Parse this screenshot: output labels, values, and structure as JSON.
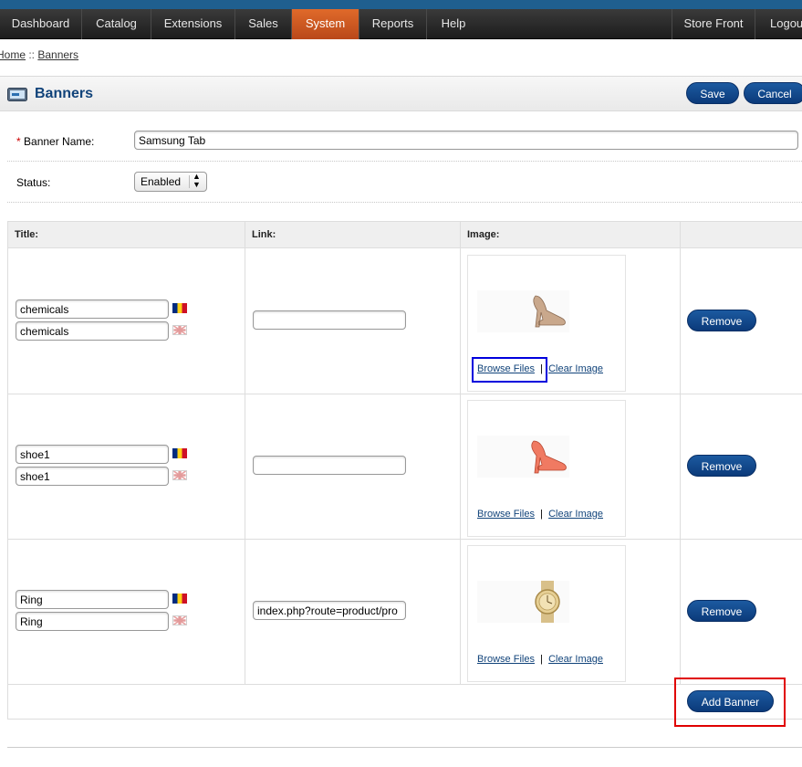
{
  "menu": {
    "items": [
      "Dashboard",
      "Catalog",
      "Extensions",
      "Sales",
      "System",
      "Reports",
      "Help"
    ],
    "active": "System",
    "right_items": [
      "Store Front",
      "Logout"
    ]
  },
  "breadcrumb": {
    "home": "Home",
    "sep": " :: ",
    "current": "Banners"
  },
  "heading": {
    "title": "Banners",
    "save": "Save",
    "cancel": "Cancel"
  },
  "form": {
    "banner_name_label": "Banner Name:",
    "required_mark": "*",
    "banner_name_value": "Samsung Tab",
    "status_label": "Status:",
    "status_value": "Enabled"
  },
  "table": {
    "headers": {
      "title": "Title:",
      "link": "Link:",
      "image": "Image:"
    },
    "rows": [
      {
        "title_ro": "chemicals",
        "title_en": "chemicals",
        "link": "",
        "image_icon": "beige-high-heel-shoe-image"
      },
      {
        "title_ro": "shoe1",
        "title_en": "shoe1",
        "link": "",
        "image_icon": "coral-high-heel-shoe-image"
      },
      {
        "title_ro": "Ring",
        "title_en": "Ring",
        "link": "index.php?route=product/pro",
        "image_icon": "gold-watch-image"
      }
    ],
    "browse_label": "Browse Files",
    "link_sep": "|",
    "clear_label": "Clear Image",
    "remove_label": "Remove",
    "add_banner_label": "Add Banner"
  },
  "colors": {
    "button_blue": "#0b3a7a",
    "menu_active": "#c9561f",
    "heading_title": "#11437a",
    "highlight_blue": "#0000dd",
    "highlight_red": "#e00000"
  }
}
